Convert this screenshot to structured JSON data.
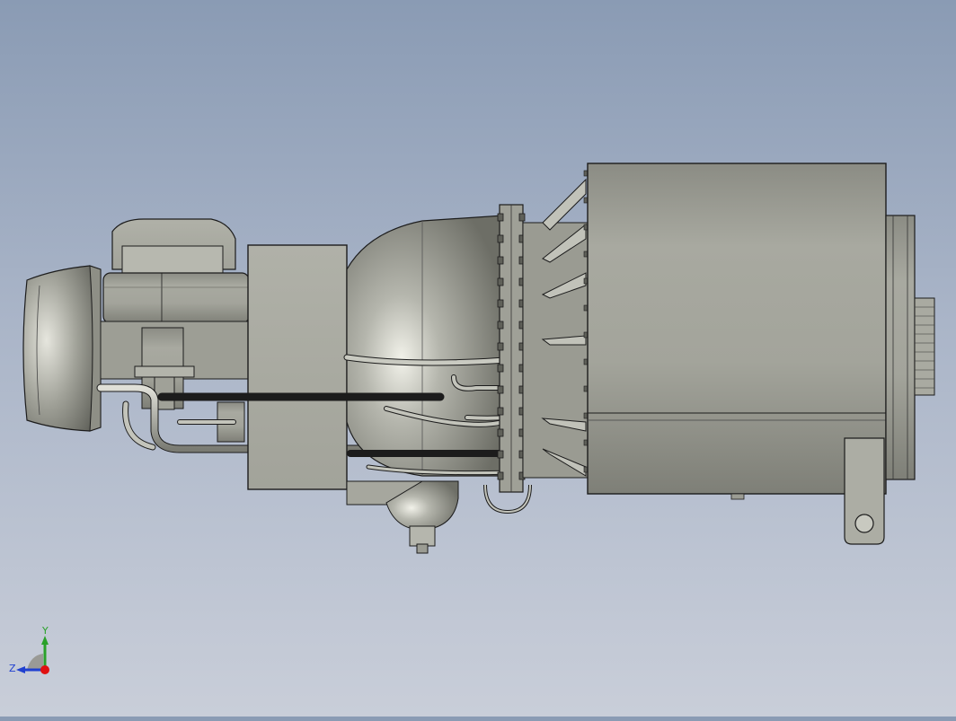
{
  "viewport": {
    "background_top": "#8a9bb4",
    "background_bottom": "#c9ced9"
  },
  "model": {
    "body_color": "#a9aaa0",
    "shadow_color": "#6d6e66",
    "highlight_color": "#e4e4dc",
    "edge_color": "#1c1c1c"
  },
  "triad": {
    "y_label": "Y",
    "z_label": "Z",
    "y_color": "#2aa12a",
    "z_color": "#2040d0",
    "x_color": "#e01010"
  }
}
